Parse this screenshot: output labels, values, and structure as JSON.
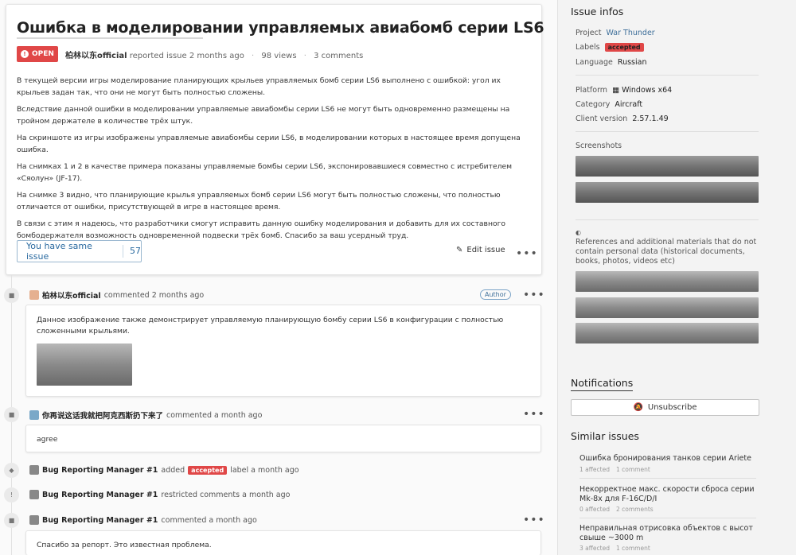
{
  "issue": {
    "title": "Ошибка в моделировании управляемых авиабомб серии LS6",
    "status": "OPEN",
    "author": "柏林以东official",
    "reported_text": "reported issue 2 months ago",
    "views": "98 views",
    "comments": "3 comments",
    "paragraphs": [
      "В текущей версии игры моделирование планирующих крыльев управляемых бомб серии LS6 выполнено с ошибкой: угол их крыльев задан так, что они не могут быть полностью сложены.",
      "Вследствие данной ошибки в моделировании управляемые авиабомбы серии LS6 не могут быть одновременно размещены на тройном держателе в количестве трёх штук.",
      "На скриншоте из игры изображены управляемые авиабомбы серии LS6, в моделировании которых в настоящее время допущена ошибка.",
      "На снимках 1 и 2 в качестве примера показаны управляемые бомбы серии LS6, экспонировавшиеся совместно с истребителем «Сяолун» (JF-17).",
      "На снимке 3 видно, что планирующие крылья управляемых бомб серии LS6 могут быть полностью сложены, что полностью отличается от ошибки, присутствующей в игре в настоящее время.",
      "В связи с этим я надеюсь, что разработчики смогут исправить данную ошибку моделирования и добавить для их составного бомбодержателя возможность одновременной подвески трёх бомб. Спасибо за ваш усердный труд."
    ],
    "same_issue_label": "You have same issue",
    "same_issue_count": "57",
    "edit_label": "Edit issue",
    "more": "•••"
  },
  "timeline": {
    "c1": {
      "author": "柏林以东official",
      "action": "commented 2 months ago",
      "tag": "Author",
      "text": "Данное изображение также демонстрирует управляемую планирующую бомбу серии LS6 в конфигурации с полностью сложенными крыльями."
    },
    "c2": {
      "author": "你再说这话我就把阿克西斯扔下来了",
      "action": "commented a month ago",
      "text": "agree"
    },
    "e1": {
      "author": "Bug Reporting Manager #1",
      "action": "added",
      "label": "accepted",
      "suffix": "label a month ago"
    },
    "e2": {
      "author": "Bug Reporting Manager #1",
      "action": "restricted comments a month ago"
    },
    "c3": {
      "author": "Bug Reporting Manager #1",
      "action": "commented a month ago",
      "text": "Спасибо за репорт. Это известная проблема."
    }
  },
  "sidebar": {
    "infos_title": "Issue infos",
    "project_label": "Project",
    "project_value": "War Thunder",
    "labels_label": "Labels",
    "labels_value": "accepted",
    "language_label": "Language",
    "language_value": "Russian",
    "platform_label": "Platform",
    "platform_value": "Windows x64",
    "category_label": "Category",
    "category_value": "Aircraft",
    "client_label": "Client version",
    "client_value": "2.57.1.49",
    "screenshots_title": "Screenshots",
    "refs_title": "References and additional materials that do not contain personal data (historical documents, books, photos, videos etc)",
    "notifications_title": "Notifications",
    "unsubscribe_label": "Unsubscribe",
    "similar_title": "Similar issues",
    "similar": [
      {
        "title": "Ошибка бронирования танков серии Ariete",
        "affected": "1 affected",
        "comments": "1 comment"
      },
      {
        "title": "Некорректное макс. скорости сброса серии Mk-8x для F-16C/D/I",
        "affected": "0 affected",
        "comments": "2 comments"
      },
      {
        "title": "Неправильная отрисовка объектов с высот свыше ~3000 m",
        "affected": "3 affected",
        "comments": "1 comment"
      }
    ]
  },
  "colors": {
    "open": "#e04747",
    "link": "#3d6e99"
  }
}
